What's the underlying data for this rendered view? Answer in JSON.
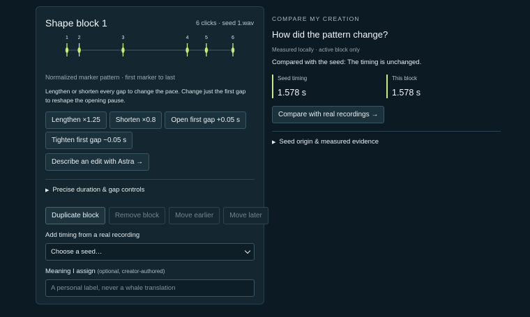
{
  "block": {
    "title": "Shape block 1",
    "meta": "6 clicks · seed 1.wav",
    "markers": [
      {
        "label": "1",
        "pos": 0.0
      },
      {
        "label": "2",
        "pos": 0.074
      },
      {
        "label": "3",
        "pos": 0.338
      },
      {
        "label": "4",
        "pos": 0.725
      },
      {
        "label": "5",
        "pos": 0.84
      },
      {
        "label": "6",
        "pos": 1.0
      }
    ],
    "caption": "Normalized marker pattern · first marker to last",
    "help": "Lengthen or shorten every gap to change the pace. Change just the first gap to reshape the opening pause.",
    "edit_buttons": [
      "Lengthen ×1.25",
      "Shorten ×0.8",
      "Open first gap +0.05 s",
      "Tighten first gap −0.05 s"
    ],
    "astra_button": "Describe an edit with Astra →",
    "precise_toggle": "Precise duration & gap controls",
    "actions": {
      "duplicate": "Duplicate block",
      "remove": "Remove block",
      "earlier": "Move earlier",
      "later": "Move later"
    },
    "timing_label": "Add timing from a real recording",
    "seed_select": "Choose a seed…",
    "meaning_label": "Meaning I assign",
    "meaning_optional": "(optional, creator-authored)",
    "meaning_placeholder": "A personal label, never a whale translation"
  },
  "compare": {
    "eyebrow": "Compare my creation",
    "question": "How did the pattern change?",
    "sub": "Measured locally · active block only",
    "result": "Compared with the seed: The timing is unchanged.",
    "seed_label": "Seed timing",
    "seed_value": "1.578 s",
    "block_label": "This block",
    "block_value": "1.578 s",
    "real_button": "Compare with real recordings →",
    "origin_toggle": "Seed origin & measured evidence"
  },
  "colors": {
    "accent": "#c8ec7a",
    "background": "#0c1a23",
    "panel": "#142730"
  }
}
